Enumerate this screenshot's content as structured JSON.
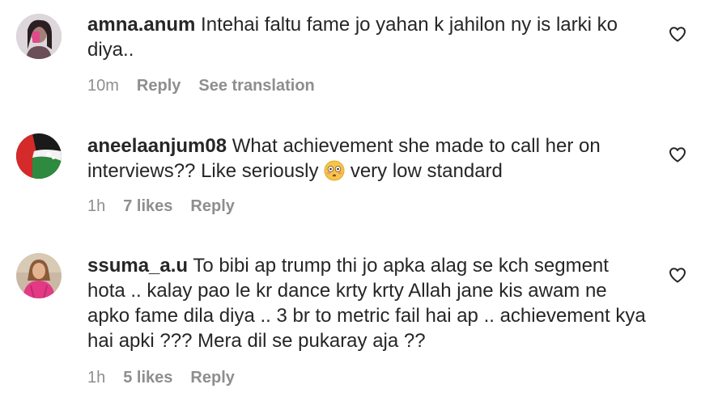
{
  "comments": [
    {
      "username": "amna.anum",
      "text": "Intehai faltu fame jo yahan k jahilon ny is larki ko diya..",
      "time": "10m",
      "reply_label": "Reply",
      "translate_label": "See translation"
    },
    {
      "username": "aneelaanjum08",
      "text_before_emoji": "What achievement she made to call her on interviews?? Like seriously",
      "emoji": "flushed-face-emoji",
      "text_after_emoji": "very low standard",
      "time": "1h",
      "likes": "7 likes",
      "reply_label": "Reply"
    },
    {
      "username": "ssuma_a.u",
      "text": "To bibi ap trump thi jo apka alag se kch segment hota .. kalay pao le kr dance krty krty Allah jane kis awam ne apko fame dila diya .. 3 br to metric fail hai ap .. achievement kya hai apki ??? Mera dil se pukaray aja ??",
      "time": "1h",
      "likes": "5 likes",
      "reply_label": "Reply"
    }
  ],
  "icons": {
    "like": "heart-outline-icon"
  },
  "colors": {
    "primary_text": "#262626",
    "secondary_text": "#8e8e8e",
    "background": "#ffffff"
  }
}
